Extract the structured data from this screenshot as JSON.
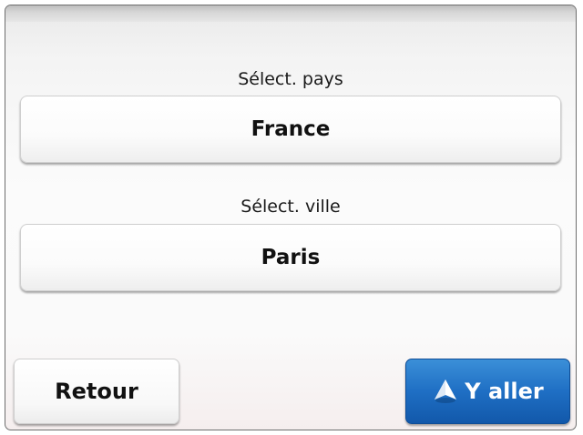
{
  "form": {
    "country_label": "Sélect. pays",
    "country_value": "France",
    "city_label": "Sélect. ville",
    "city_value": "Paris"
  },
  "footer": {
    "back_label": "Retour",
    "go_label": "Y aller"
  },
  "icons": {
    "go": "navigation-arrow-icon"
  },
  "colors": {
    "go_button": "#1f6fc4",
    "frame_border": "#6e6e6e"
  }
}
